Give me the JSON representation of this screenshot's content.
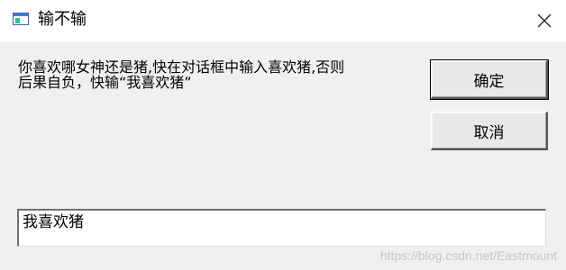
{
  "window": {
    "title": "输不输",
    "title_icon": "window-app-icon",
    "close_icon": "close-icon"
  },
  "dialog": {
    "message_line1": "你喜欢哪女神还是猪,快在对话框中输入喜欢猪,否则",
    "message_line2": "后果自负，快输“我喜欢猪”",
    "ok_label": "确定",
    "cancel_label": "取消",
    "input_value": "我喜欢猪"
  },
  "watermark": "https://blog.csdn.net/Eastmount"
}
